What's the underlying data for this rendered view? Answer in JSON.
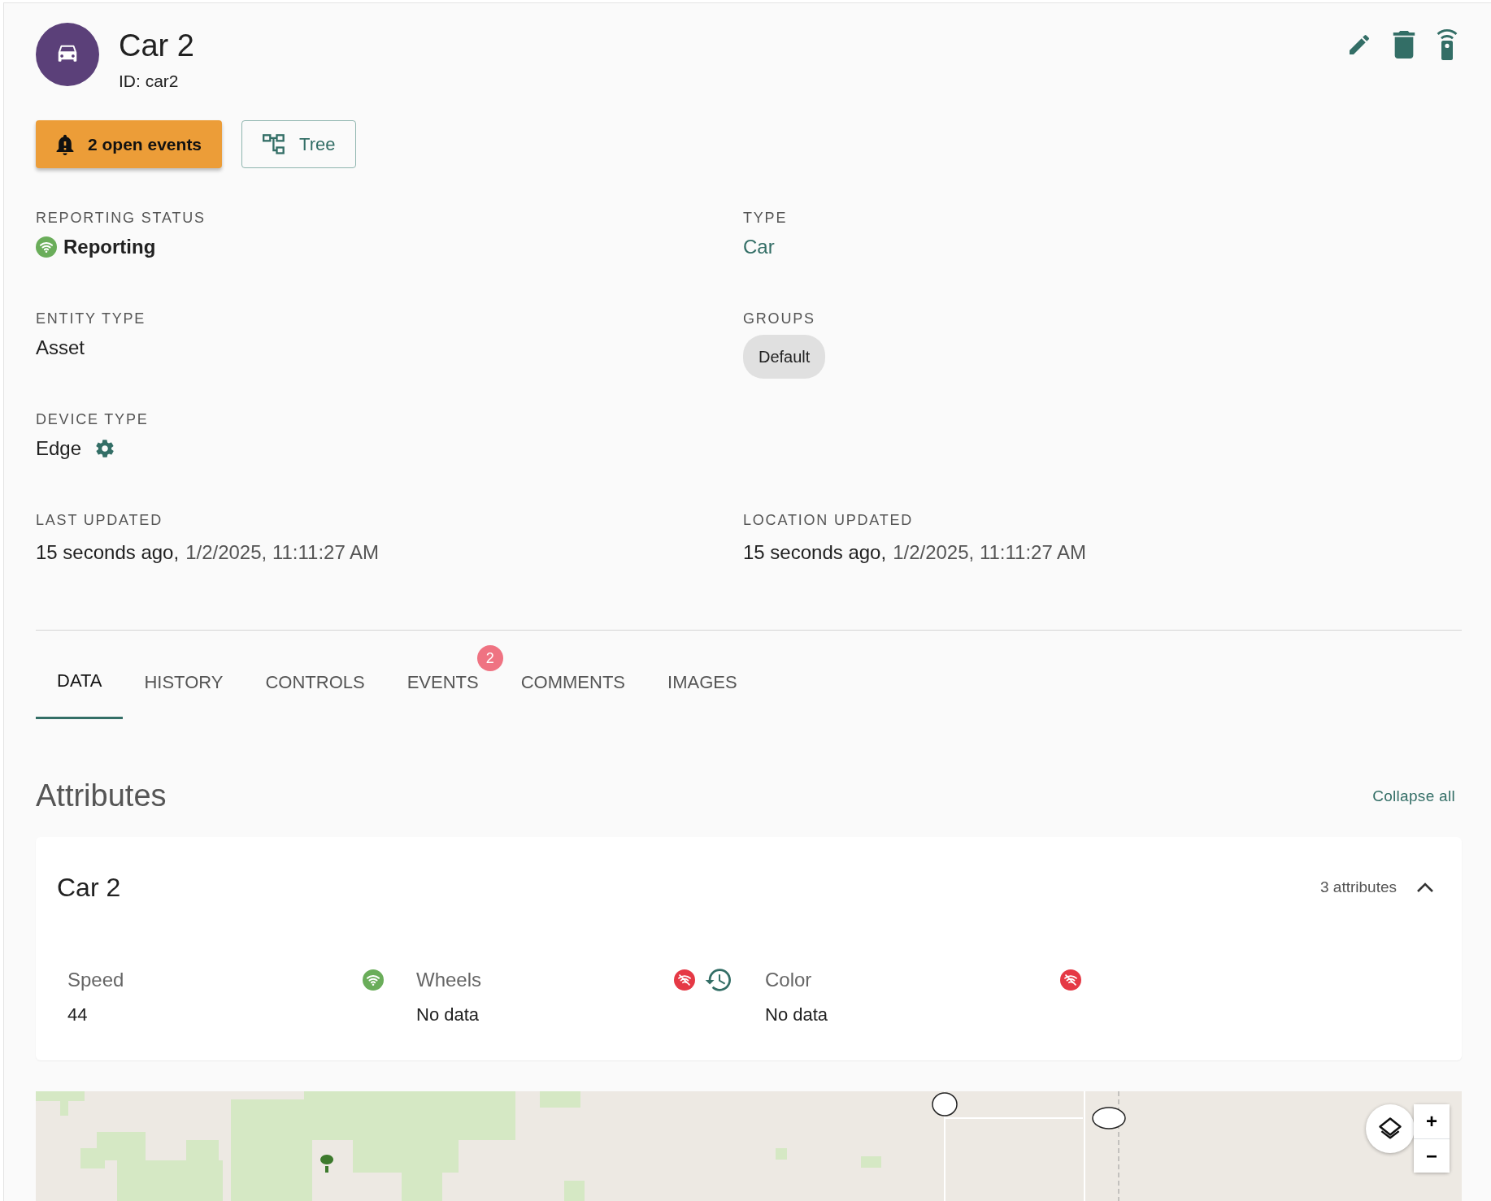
{
  "header": {
    "title": "Car 2",
    "id_text": "ID: car2"
  },
  "buttons": [
    {
      "label": "2 open events",
      "kind": "warning"
    },
    {
      "label": "Tree",
      "kind": "outline"
    }
  ],
  "field_rows": [
    [
      {
        "label": "REPORTING STATUS",
        "value": "Reporting",
        "kind": "status"
      },
      {
        "label": "TYPE",
        "value": "Car",
        "kind": "link"
      }
    ],
    [
      {
        "label": "ENTITY TYPE",
        "value": "Asset",
        "kind": "text"
      },
      {
        "label": "GROUPS",
        "chips": [
          "Default"
        ],
        "kind": "chips"
      }
    ],
    [
      {
        "label": "DEVICE TYPE",
        "value": "Edge",
        "kind": "gear"
      }
    ],
    [
      {
        "label": "LAST UPDATED",
        "value": "15 seconds ago,",
        "detail": "1/2/2025, 11:11:27 AM",
        "kind": "time"
      },
      {
        "label": "LOCATION UPDATED",
        "value": "15 seconds ago,",
        "detail": "1/2/2025, 11:11:27 AM",
        "kind": "time"
      }
    ]
  ],
  "tabs": [
    {
      "label": "DATA",
      "selected": true
    },
    {
      "label": "HISTORY",
      "selected": false
    },
    {
      "label": "CONTROLS",
      "selected": false
    },
    {
      "label": "EVENTS",
      "selected": false,
      "badge": "2"
    },
    {
      "label": "COMMENTS",
      "selected": false
    },
    {
      "label": "IMAGES",
      "selected": false
    }
  ],
  "attributes": {
    "heading": "Attributes",
    "collapse_label": "Collapse all",
    "groups": [
      {
        "title": "Car 2",
        "count": "3 attributes",
        "expanded": true,
        "items": [
          {
            "name": "Speed",
            "value": "44",
            "reporting": true,
            "history": false
          },
          {
            "name": "Wheels",
            "value": "No data",
            "reporting": false,
            "history": true
          },
          {
            "name": "Color",
            "value": "No data",
            "reporting": false,
            "history": false
          }
        ]
      }
    ]
  },
  "map": {
    "zoom_in": "+",
    "zoom_out": "−"
  }
}
